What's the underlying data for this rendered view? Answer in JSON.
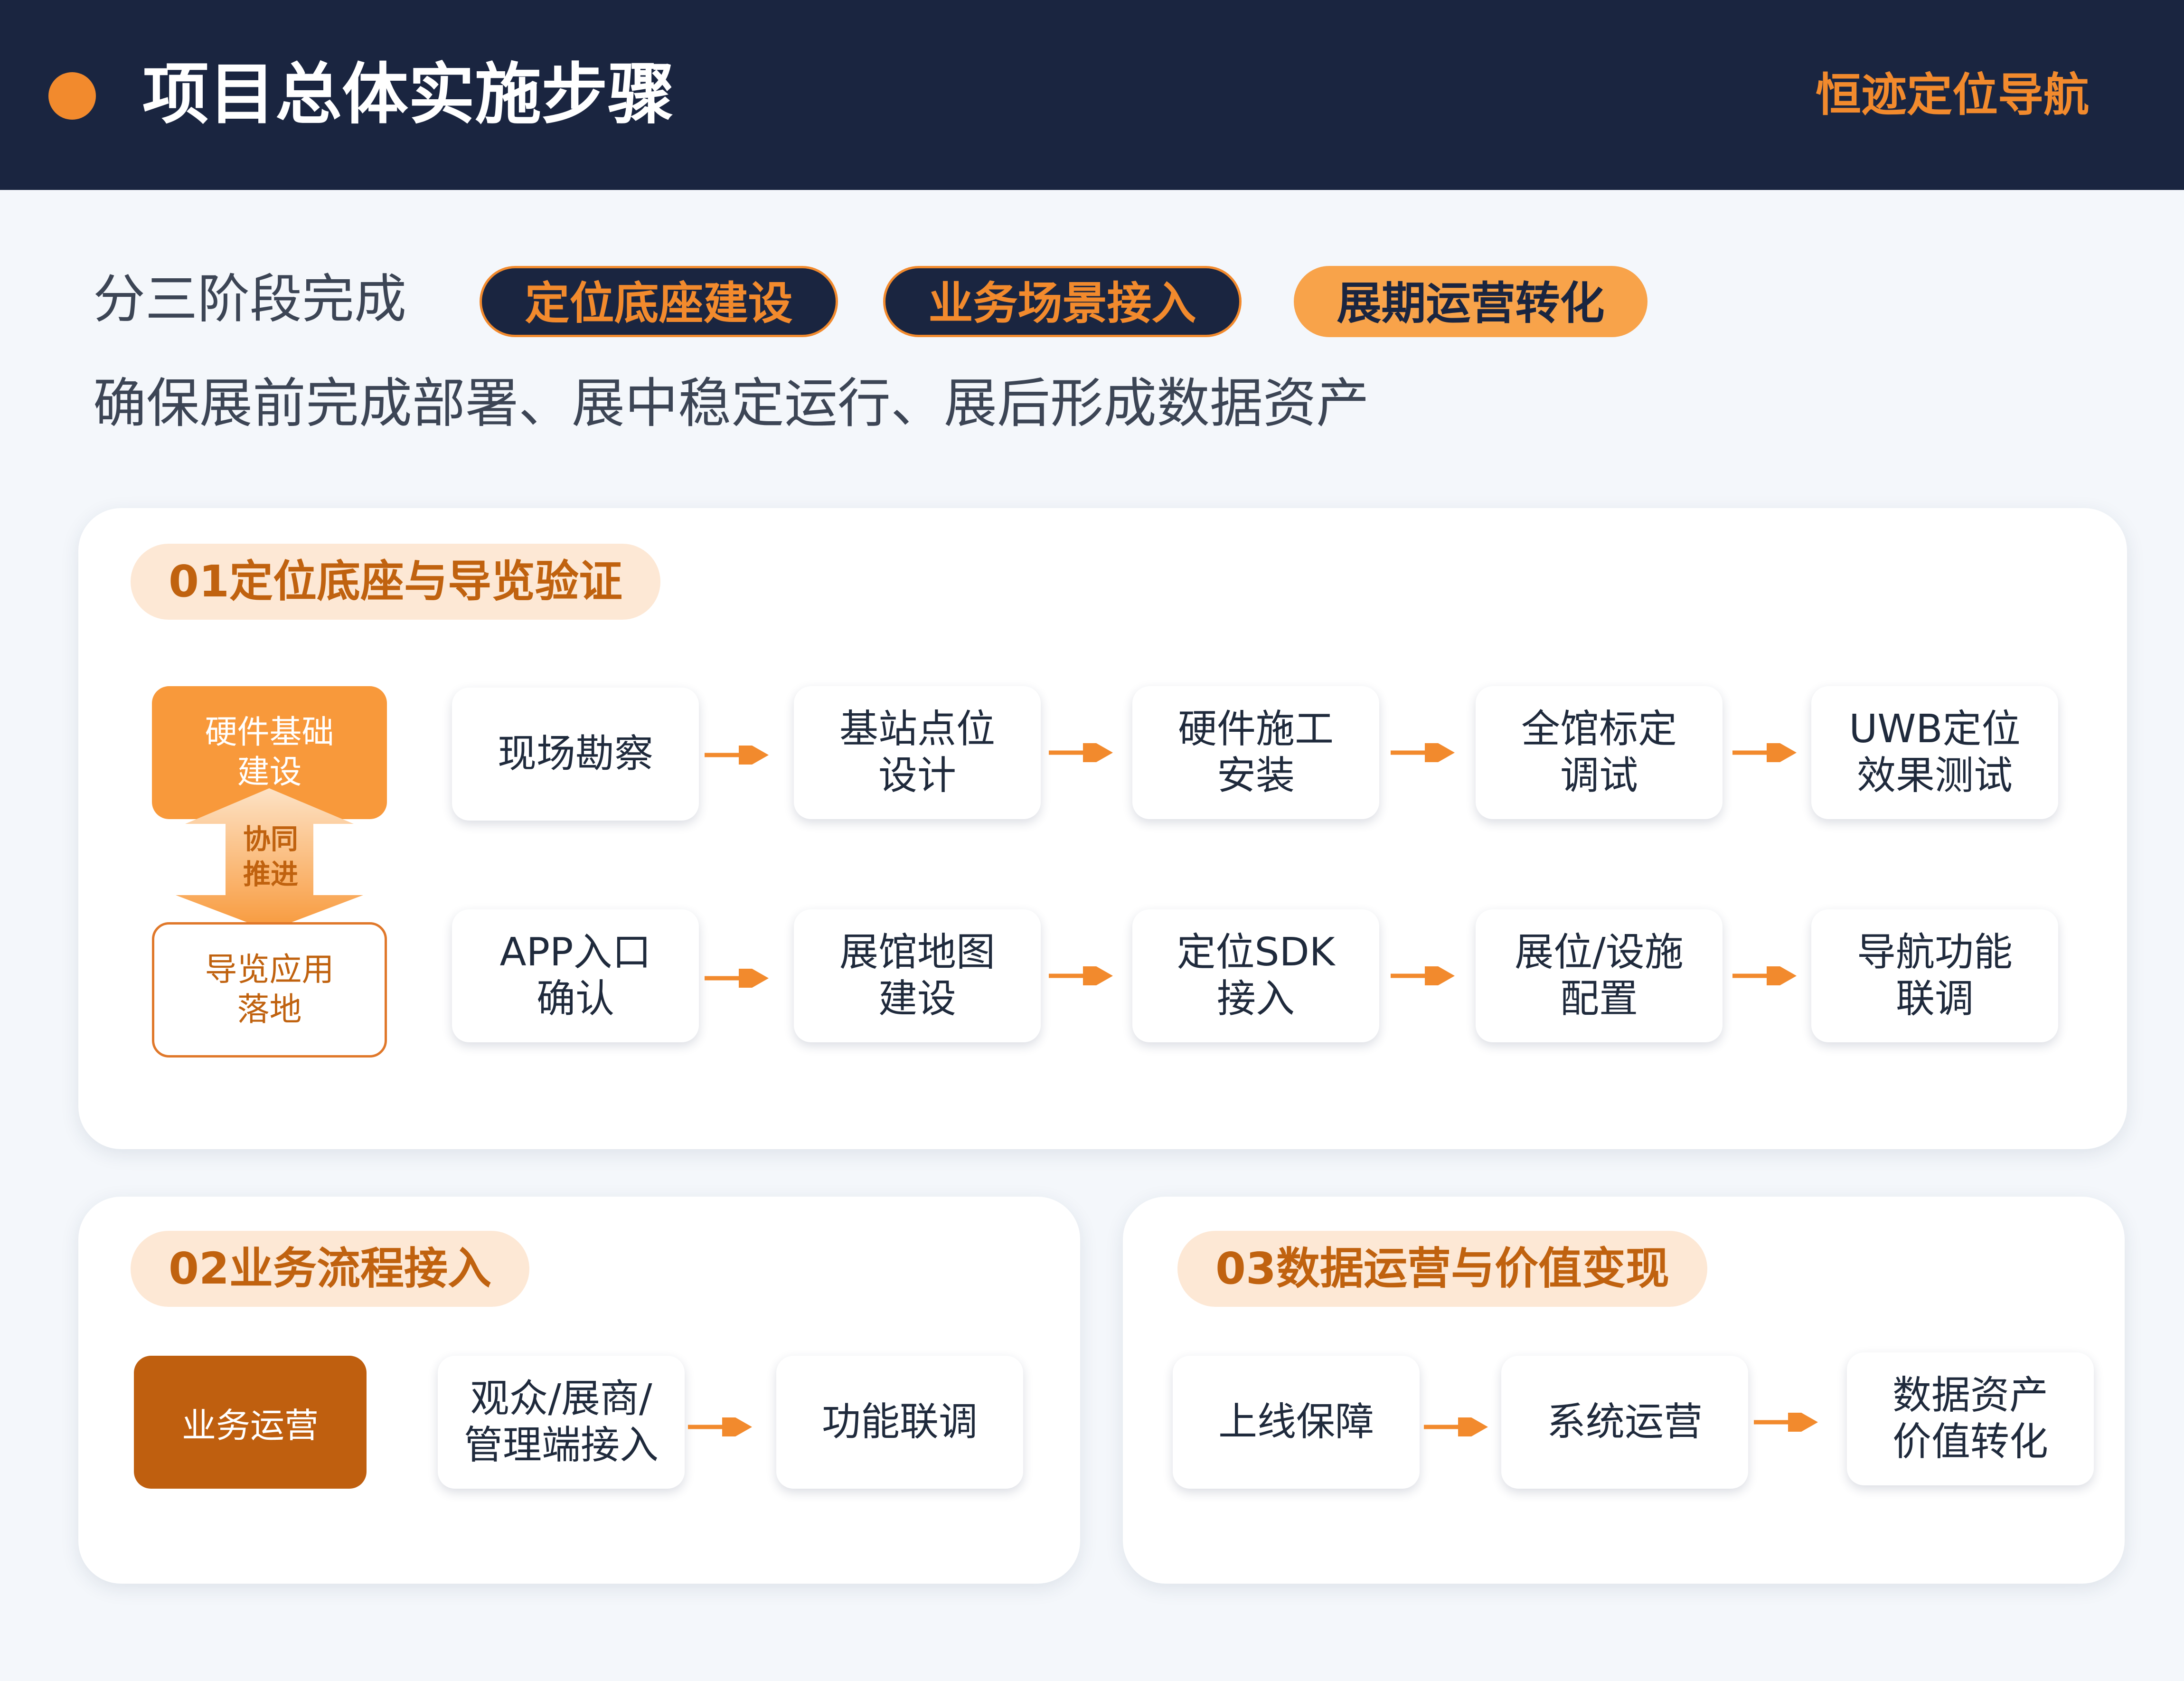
{
  "header": {
    "title": "项目总体实施步骤",
    "brand": "恒迹定位导航"
  },
  "intro": {
    "label": "分三阶段完成",
    "stages": [
      "定位底座建设",
      "业务场景接入",
      "展期运营转化"
    ],
    "summary": "确保展前完成部署、展中稳定运行、展后形成数据资产"
  },
  "phase1": {
    "tag": "01定位底座与导览验证",
    "hardware_label": "硬件基础\n建设",
    "collab_label": "协同\n推进",
    "guide_label": "导览应用\n落地",
    "row1": [
      "现场勘察",
      "基站点位\n设计",
      "硬件施工\n安装",
      "全馆标定\n调试",
      "UWB定位\n效果测试"
    ],
    "row2": [
      "APP入口\n确认",
      "展馆地图\n建设",
      "定位SDK\n接入",
      "展位/设施\n配置",
      "导航功能\n联调"
    ]
  },
  "phase2": {
    "tag": "02业务流程接入",
    "lead_label": "业务运营",
    "steps": [
      "观众/展商/\n管理端接入",
      "功能联调"
    ]
  },
  "phase3": {
    "tag": "03数据运营与价值变现",
    "steps": [
      "上线保障",
      "系统运营",
      "数据资产\n价值转化"
    ]
  },
  "colors": {
    "navy": "#1a2540",
    "orange": "#f28a2d",
    "dark_orange": "#bf5f0f",
    "tag_bg": "#fde8d5"
  }
}
